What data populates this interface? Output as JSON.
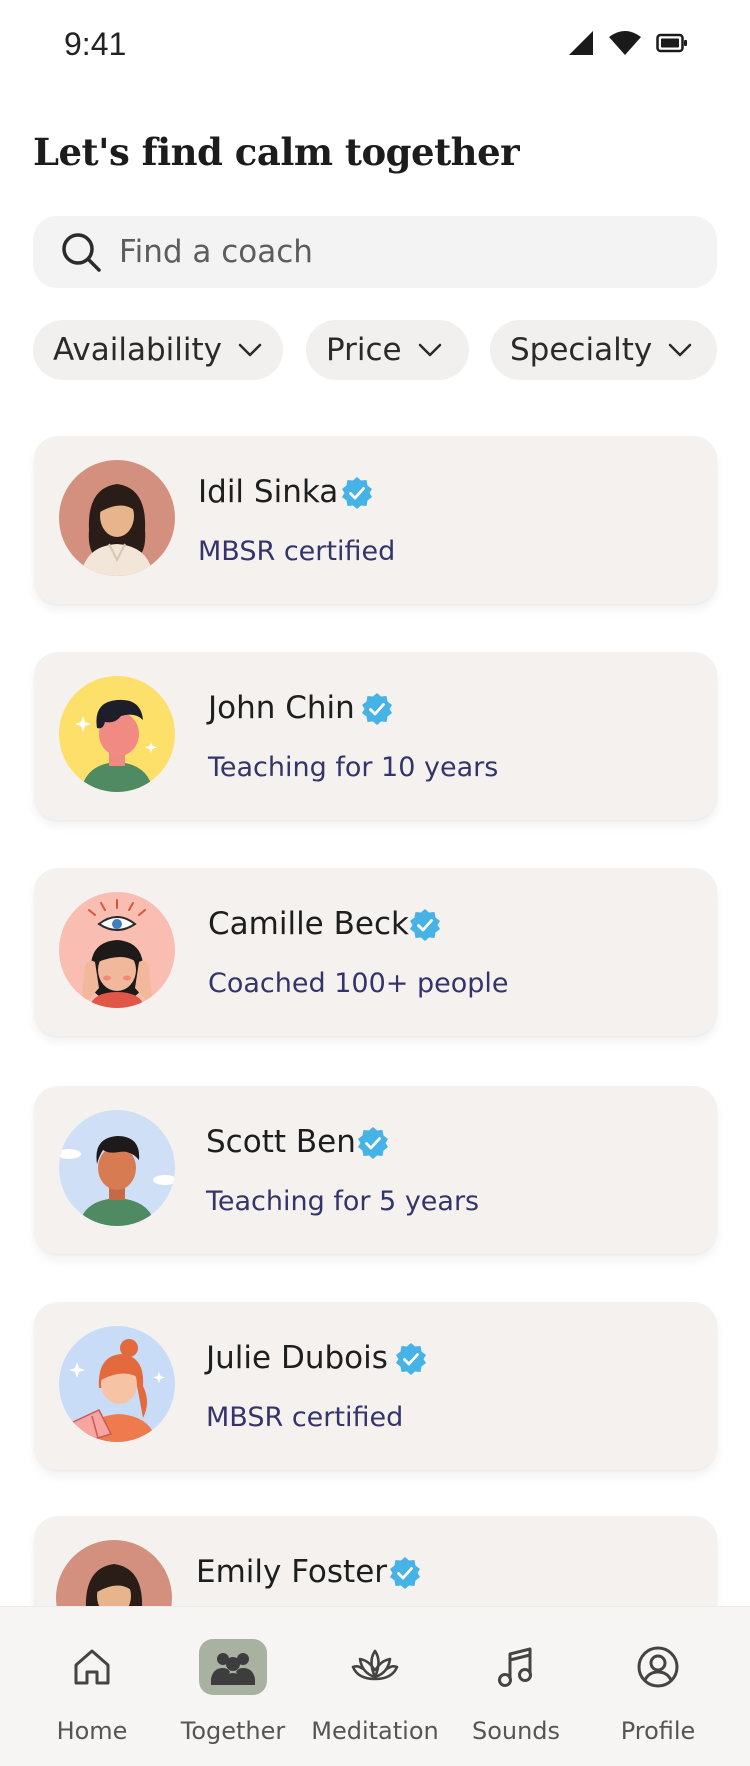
{
  "status_bar": {
    "time": "9:41"
  },
  "title": "Let's find calm together",
  "search": {
    "placeholder": "Find a coach",
    "value": ""
  },
  "filters": [
    {
      "label": "Availability"
    },
    {
      "label": "Price"
    },
    {
      "label": "Specialty"
    }
  ],
  "coaches": [
    {
      "name": "Idil Sinka",
      "subtitle": "MBSR certified",
      "verified": true,
      "avatar_bg": "#d4907e"
    },
    {
      "name": "John Chin",
      "subtitle": "Teaching for 10 years",
      "verified": true,
      "avatar_bg": "#fde06a"
    },
    {
      "name": "Camille Beck",
      "subtitle": "Coached 100+ people",
      "verified": true,
      "avatar_bg": "#f9bdb2"
    },
    {
      "name": "Scott Ben",
      "subtitle": "Teaching for 5 years",
      "verified": true,
      "avatar_bg": "#cfe0f6"
    },
    {
      "name": "Julie Dubois",
      "subtitle": "MBSR certified",
      "verified": true,
      "avatar_bg": "#c8dcf7"
    },
    {
      "name": "Emily Foster",
      "subtitle": "",
      "verified": true,
      "avatar_bg": "#d4907e"
    }
  ],
  "nav": [
    {
      "label": "Home",
      "icon": "home-icon",
      "active": false
    },
    {
      "label": "Together",
      "icon": "people-icon",
      "active": true
    },
    {
      "label": "Meditation",
      "icon": "lotus-icon",
      "active": false
    },
    {
      "label": "Sounds",
      "icon": "music-note-icon",
      "active": false
    },
    {
      "label": "Profile",
      "icon": "profile-icon",
      "active": false
    }
  ],
  "colors": {
    "accent_nav": "#a9b2a0",
    "verified_badge": "#45b3e6",
    "subtitle_text": "#34346a",
    "card_bg": "#f4f1ee"
  }
}
